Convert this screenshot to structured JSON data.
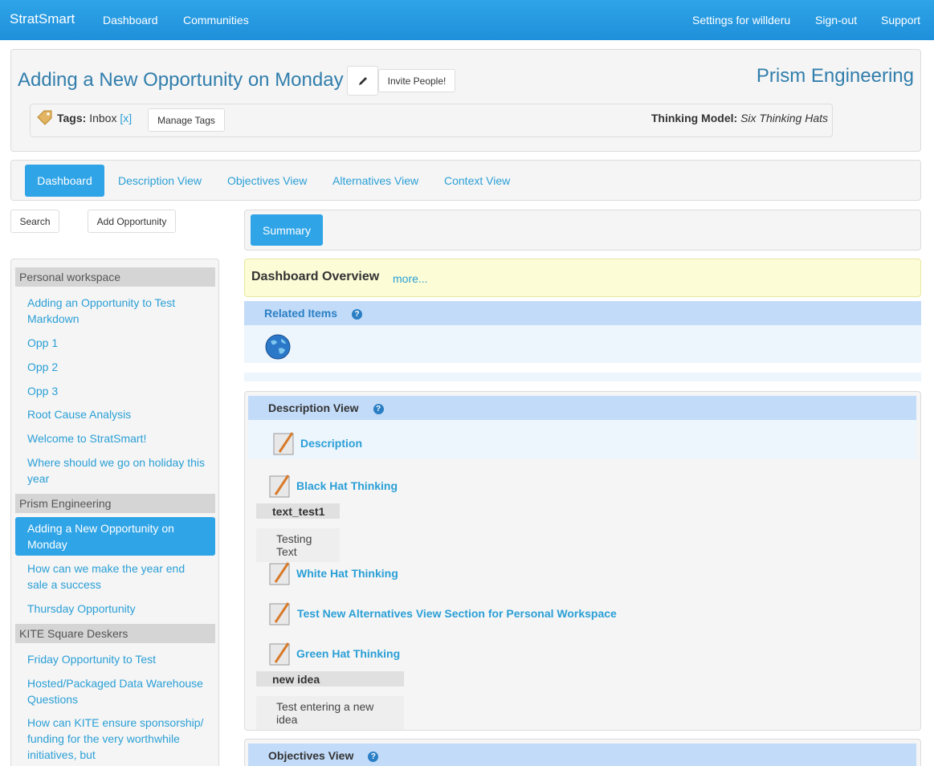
{
  "navbar": {
    "brand": "StratSmart",
    "left": [
      "Dashboard",
      "Communities"
    ],
    "right": [
      "Settings for willderu",
      "Sign-out",
      "Support"
    ]
  },
  "header": {
    "title": "Adding a New Opportunity on Monday",
    "invite": "Invite People!",
    "org": "Prism Engineering",
    "tags_label": "Tags:",
    "tag": "Inbox",
    "tag_remove": "[x]",
    "manage_tags": "Manage Tags",
    "thinking_label": "Thinking Model:",
    "thinking_value": "Six Thinking Hats"
  },
  "tabs": [
    "Dashboard",
    "Description View",
    "Objectives View",
    "Alternatives View",
    "Context View"
  ],
  "sidebar": {
    "search": "Search",
    "add": "Add Opportunity",
    "groups": [
      {
        "name": "Personal workspace",
        "items": [
          "Adding an Opportunity to Test Markdown",
          "Opp 1",
          "Opp 2",
          "Opp 3",
          "Root Cause Analysis",
          "Welcome to StratSmart!",
          "Where should we go on holiday this year"
        ]
      },
      {
        "name": "Prism Engineering",
        "items": [
          "Adding a New Opportunity on Monday",
          "How can we make the year end sale a success",
          "Thursday Opportunity"
        ]
      },
      {
        "name": "KITE Square Deskers",
        "items": [
          "Friday Opportunity to Test",
          "Hosted/Packaged Data Warehouse Questions",
          "How can KITE ensure sponsorship/ funding for the very worthwhile initiatives, but"
        ]
      }
    ]
  },
  "main": {
    "summary": "Summary",
    "overview_title": "Dashboard Overview",
    "overview_more": "more...",
    "related": "Related Items",
    "help": "?",
    "description_view": "Description View",
    "description": "Description",
    "black_hat": "Black Hat Thinking",
    "field1_label": "text_test1",
    "field1_value": "Testing Text",
    "white_hat": "White Hat Thinking",
    "test_alt": "Test New Alternatives View Section for Personal Workspace",
    "green_hat": "Green Hat Thinking",
    "field2_label": "new idea",
    "field2_value": "Test entering a new idea",
    "objectives_view": "Objectives View"
  },
  "colors": {
    "accent": "#2fa4e7",
    "link": "#2a9fd6",
    "title": "#317eac"
  },
  "icons": [
    "pencil-icon",
    "tag-icon",
    "globe-icon",
    "notepad-icon",
    "help-icon"
  ]
}
